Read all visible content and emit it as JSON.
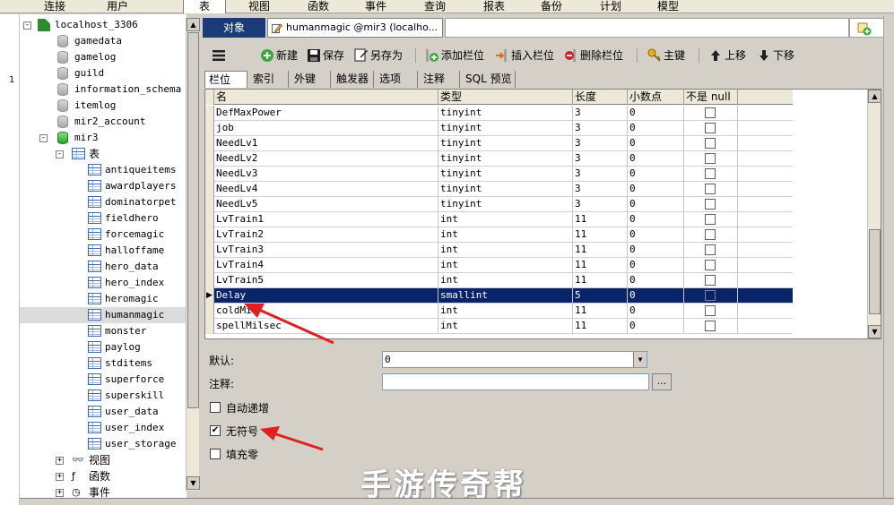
{
  "menubar": {
    "items": [
      "连接",
      "用户",
      "表",
      "视图",
      "函数",
      "事件",
      "查询",
      "报表",
      "备份",
      "计划",
      "模型"
    ],
    "active": "表"
  },
  "gutter": {
    "line_number": "1"
  },
  "tree": {
    "connection": "localhost_3306",
    "databases": [
      "gamedata",
      "gamelog",
      "guild",
      "information_schema",
      "itemlog",
      "mir2_account"
    ],
    "open_db": "mir3",
    "tables_folder": "表",
    "tables": [
      "antiqueitems",
      "awardplayers",
      "dominatorpet",
      "fieldhero",
      "forcemagic",
      "halloffame",
      "hero_data",
      "hero_index",
      "heromagic",
      "humanmagic",
      "monster",
      "paylog",
      "stditems",
      "superforce",
      "superskill",
      "user_data",
      "user_index",
      "user_storage"
    ],
    "selected_table": "humanmagic",
    "folders": [
      "视图",
      "函数",
      "事件"
    ]
  },
  "doc_tabs": {
    "objects_label": "对象",
    "table_tab_label": "humanmagic @mir3 (localho..."
  },
  "toolbar": {
    "new": "新建",
    "save": "保存",
    "save_as": "另存为",
    "add_field": "添加栏位",
    "insert_field": "插入栏位",
    "delete_field": "删除栏位",
    "primary_key": "主键",
    "move_up": "上移",
    "move_down": "下移"
  },
  "inner_tabs": [
    "栏位",
    "索引",
    "外键",
    "触发器",
    "选项",
    "注释",
    "SQL 预览"
  ],
  "grid": {
    "columns": [
      "名",
      "类型",
      "长度",
      "小数点",
      "不是 null"
    ],
    "rows": [
      {
        "name": "DefMaxPower",
        "type": "tinyint",
        "length": "3",
        "decimals": "0"
      },
      {
        "name": "job",
        "type": "tinyint",
        "length": "3",
        "decimals": "0"
      },
      {
        "name": "NeedLv1",
        "type": "tinyint",
        "length": "3",
        "decimals": "0"
      },
      {
        "name": "NeedLv2",
        "type": "tinyint",
        "length": "3",
        "decimals": "0"
      },
      {
        "name": "NeedLv3",
        "type": "tinyint",
        "length": "3",
        "decimals": "0"
      },
      {
        "name": "NeedLv4",
        "type": "tinyint",
        "length": "3",
        "decimals": "0"
      },
      {
        "name": "NeedLv5",
        "type": "tinyint",
        "length": "3",
        "decimals": "0"
      },
      {
        "name": "LvTrain1",
        "type": "int",
        "length": "11",
        "decimals": "0"
      },
      {
        "name": "LvTrain2",
        "type": "int",
        "length": "11",
        "decimals": "0"
      },
      {
        "name": "LvTrain3",
        "type": "int",
        "length": "11",
        "decimals": "0"
      },
      {
        "name": "LvTrain4",
        "type": "int",
        "length": "11",
        "decimals": "0"
      },
      {
        "name": "LvTrain5",
        "type": "int",
        "length": "11",
        "decimals": "0"
      },
      {
        "name": "Delay",
        "type": "smallint",
        "length": "5",
        "decimals": "0"
      },
      {
        "name": "coldMil",
        "type": "int",
        "length": "11",
        "decimals": "0"
      },
      {
        "name": "spellMilsec",
        "type": "int",
        "length": "11",
        "decimals": "0"
      }
    ],
    "selected_row": "Delay"
  },
  "props": {
    "default_label": "默认:",
    "default_value": "0",
    "comment_label": "注释:",
    "comment_value": "",
    "ellipsis": "...",
    "auto_increment_label": "自动递增",
    "auto_increment_checked": false,
    "unsigned_label": "无符号",
    "unsigned_checked": true,
    "zerofill_label": "填充零",
    "zerofill_checked": false
  },
  "watermark": "手游传奇帮",
  "colors": {
    "selection": "#0a246a",
    "objects_tab": "#1a3a78",
    "annotation_arrow": "#e02020"
  }
}
